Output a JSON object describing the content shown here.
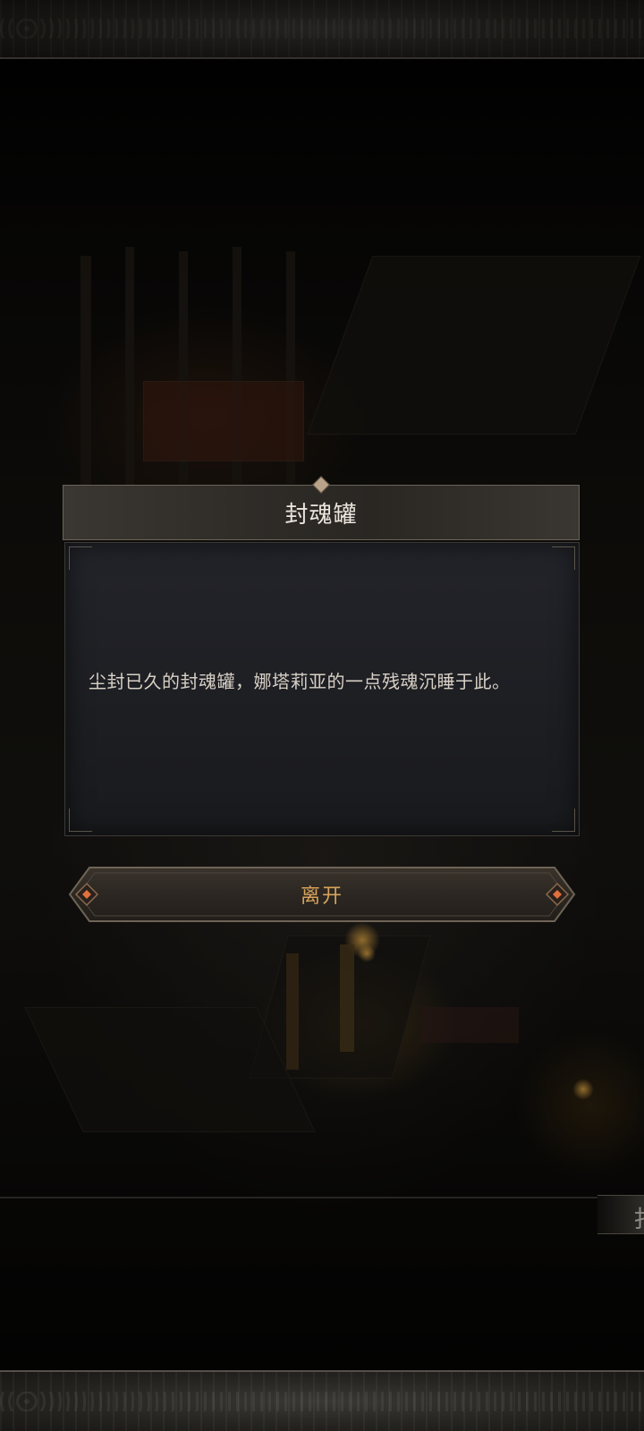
{
  "dialog": {
    "title": "封魂罐",
    "description": "尘封已久的封魂罐，娜塔莉亚的一点残魂沉睡于此。"
  },
  "leave_button": {
    "label": "离开"
  },
  "edge_tab": {
    "label": "扌"
  },
  "colors": {
    "title_text": "#ece6de",
    "body_text": "#d8d0c6",
    "button_text": "#d7a45c",
    "button_gem": "#e0703c"
  }
}
